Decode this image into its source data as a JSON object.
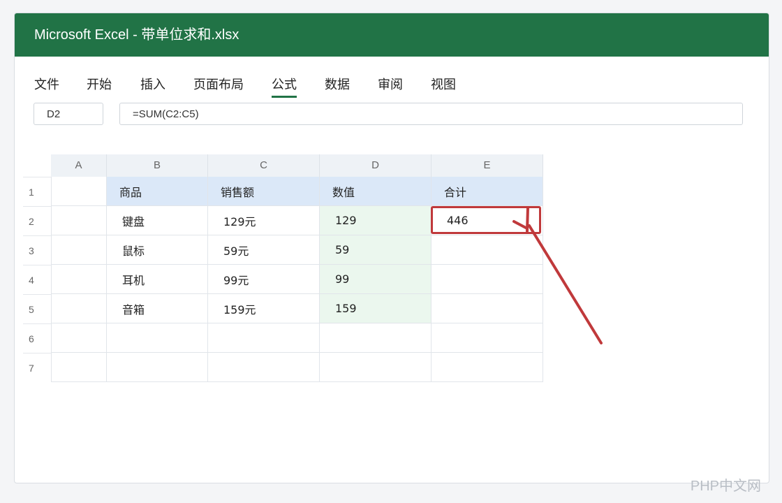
{
  "window": {
    "title": "Microsoft Excel - 带单位求和.xlsx"
  },
  "menu": [
    {
      "label": "文件",
      "active": false
    },
    {
      "label": "开始",
      "active": false
    },
    {
      "label": "插入",
      "active": false
    },
    {
      "label": "页面布局",
      "active": false
    },
    {
      "label": "公式",
      "active": true
    },
    {
      "label": "数据",
      "active": false
    },
    {
      "label": "审阅",
      "active": false
    },
    {
      "label": "视图",
      "active": false
    }
  ],
  "name_box": "D2",
  "formula": "=SUM(C2:C5)",
  "columns": [
    "A",
    "B",
    "C",
    "D",
    "E"
  ],
  "rows": [
    {
      "num": "1",
      "cells": [
        "",
        "商品",
        "销售额",
        "数值",
        "合计"
      ]
    },
    {
      "num": "2",
      "cells": [
        "",
        "键盘",
        "129元",
        "129",
        "446"
      ]
    },
    {
      "num": "3",
      "cells": [
        "",
        "鼠标",
        "59元",
        "59",
        ""
      ]
    },
    {
      "num": "4",
      "cells": [
        "",
        "耳机",
        "99元",
        "99",
        ""
      ]
    },
    {
      "num": "5",
      "cells": [
        "",
        "音箱",
        "159元",
        "159",
        ""
      ]
    },
    {
      "num": "6",
      "cells": [
        "",
        "",
        "",
        "",
        ""
      ]
    },
    {
      "num": "7",
      "cells": [
        "",
        "",
        "",
        "",
        ""
      ]
    }
  ],
  "annotation_color": "#c0393b",
  "accent_color": "#217346",
  "watermark": "PHP中文网"
}
